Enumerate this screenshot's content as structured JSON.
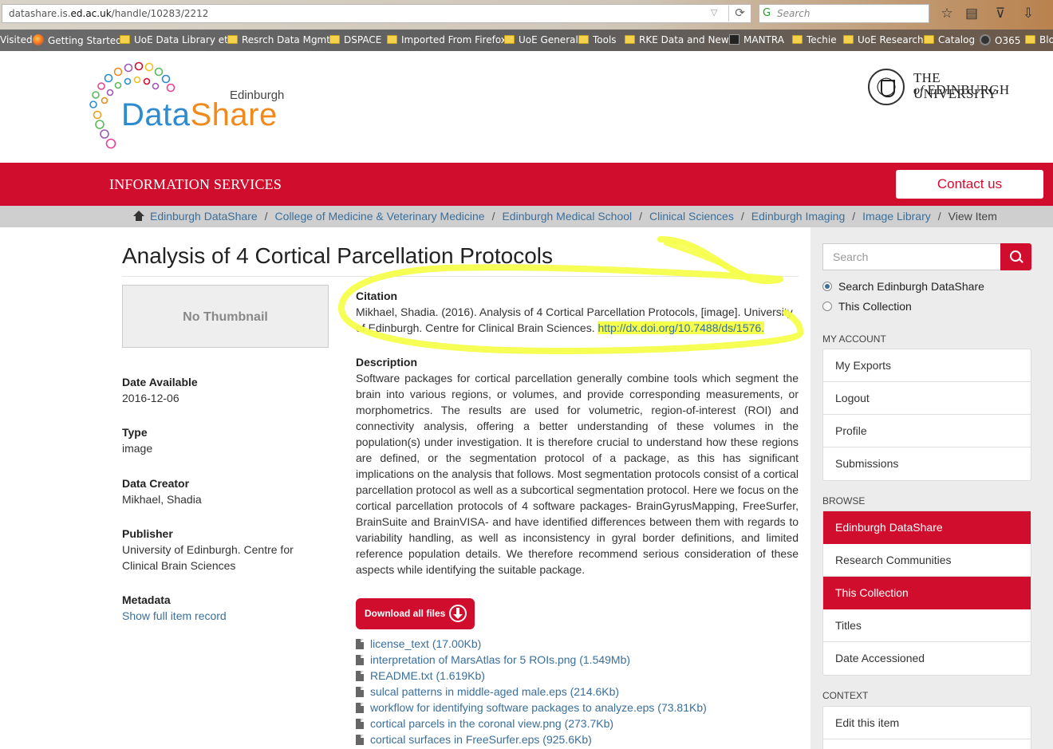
{
  "browser": {
    "url_prefix": "datashare.is.",
    "url_domain": "ed.ac.uk",
    "url_path": "/handle/10283/2212",
    "search_placeholder": "Search",
    "bookmarks": [
      "Visited",
      "Getting Started",
      "UoE Data Library etc",
      "Resrch Data Mgmt",
      "DSPACE",
      "Imported From Firefox",
      "UoE General",
      "Tools",
      "RKE Data and News",
      "MANTRA",
      "Techie",
      "UoE Research",
      "Catalog",
      "O365",
      "Blo"
    ]
  },
  "site": {
    "logo_edinburgh": "Edinburgh",
    "logo_data": "Data",
    "logo_share": "Share",
    "uoe_line1": "THE UNIVERSITY",
    "uoe_of": "of",
    "uoe_line2": "EDINBURGH",
    "info_services": "INFORMATION SERVICES",
    "contact_us": "Contact us"
  },
  "breadcrumbs": [
    "Edinburgh DataShare",
    "College of Medicine & Veterinary Medicine",
    "Edinburgh Medical School",
    "Clinical Sciences",
    "Edinburgh Imaging",
    "Image Library"
  ],
  "breadcrumb_current": "View Item",
  "item": {
    "title": "Analysis of 4 Cortical Parcellation Protocols",
    "thumbnail": "No Thumbnail",
    "date_label": "Date Available",
    "date_value": "2016-12-06",
    "type_label": "Type",
    "type_value": "image",
    "creator_label": "Data Creator",
    "creator_value": "Mikhael, Shadia",
    "publisher_label": "Publisher",
    "publisher_value": "University of Edinburgh. Centre for Clinical Brain Sciences",
    "metadata_label": "Metadata",
    "metadata_link": "Show full item record",
    "citation_label": "Citation",
    "citation_text": "Mikhael, Shadia. (2016). Analysis of 4 Cortical Parcellation Protocols, [image]. University of Edinburgh. Centre for Clinical Brain Sciences.",
    "citation_doi": "http://dx.doi.org/10.7488/ds/1576.",
    "description_label": "Description",
    "description": "Software packages for cortical parcellation generally combine tools which segment the brain into various regions, or volumes, and provide corresponding measurements, or morphometrics. The results are used for volumetric, region-of-interest (ROI) and connectivity analysis, offering a better understanding of these volumes in the population(s) under investigation. It is therefore crucial to understand how these regions are defined, or the segmentation protocol of a package, as this has significant implications on the analysis that follows. Most segmentation protocols consist of a cortical parcellation protocol as well as a subcortical segmentation protocol. Here we focus on the cortical parcellation protocols of 4 software packages- BrainGyrusMapping, FreeSurfer, BrainSuite and BrainVISA- and have identified differences between them with regards to variability handling, as well as inconsistency in gyral border definitions, and limited reference population details. We therefore recommend serious consideration of these aspects while identifying the suitable package.",
    "download_all": "Download all files",
    "files": [
      "license_text (17.00Kb)",
      "interpretation of MarsAtlas for 5 ROIs.png (1.549Mb)",
      "README.txt (1.619Kb)",
      "sulcal patterns in middle-aged male.eps (214.6Kb)",
      "workflow for identifying software packages to analyze.eps (73.81Kb)",
      "cortical parcels in the coronal view.png (273.7Kb)",
      "cortical surfaces in FreeSurfer.eps (925.6Kb)"
    ]
  },
  "sidebar": {
    "search_placeholder": "Search",
    "scope_all": "Search Edinburgh DataShare",
    "scope_collection": "This Collection",
    "my_account_head": "MY ACCOUNT",
    "my_account": [
      "My Exports",
      "Logout",
      "Profile",
      "Submissions"
    ],
    "browse_head": "BROWSE",
    "browse": [
      "Edinburgh DataShare",
      "Research Communities",
      "This Collection",
      "Titles",
      "Date Accessioned"
    ],
    "context_head": "CONTEXT",
    "context": [
      "Edit this item"
    ]
  },
  "colors": {
    "brand_red": "#d10d2d",
    "link_blue": "#3a6f9c",
    "highlight_yellow": "#f5ff4a"
  }
}
